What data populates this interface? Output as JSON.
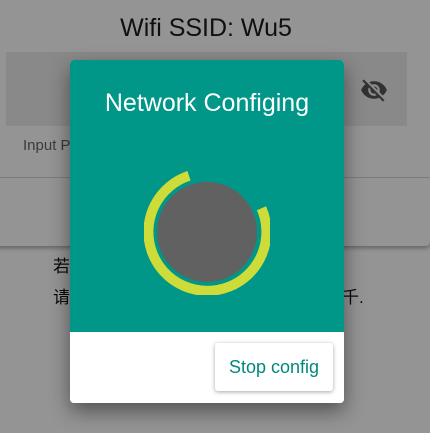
{
  "header": {
    "ssid_title": "Wifi SSID: Wu5"
  },
  "password": {
    "hint": "Input P"
  },
  "tips": {
    "line1": "若",
    "line2": "请",
    "line2_tail": "千."
  },
  "dialog": {
    "title": "Network Configing",
    "stop_label": "Stop config"
  },
  "colors": {
    "dialog_header": "#009688",
    "spinner_arc": "#cddc39",
    "spinner_knob": "#616161",
    "action_text": "#00897b"
  }
}
